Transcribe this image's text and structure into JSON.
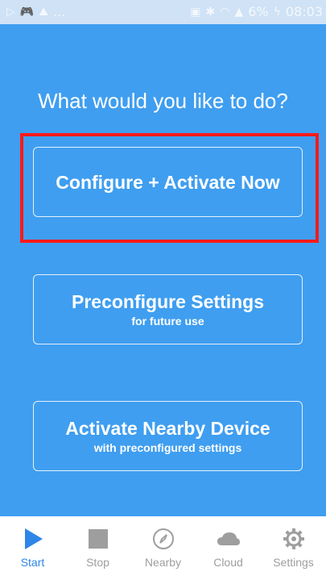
{
  "status_bar": {
    "left_icons": [
      "play-icon",
      "gamepad-icon",
      "mountain-icon"
    ],
    "ellipsis": "...",
    "battery_percent": "6%",
    "time": "08:03",
    "right_icons": [
      "nfc-icon",
      "bluetooth-icon",
      "wifi-icon",
      "signal-icon",
      "battery-charging-icon"
    ]
  },
  "main": {
    "heading": "What would you like to do?",
    "actions": [
      {
        "title": "Configure + Activate Now",
        "subtitle": ""
      },
      {
        "title": "Preconfigure Settings",
        "subtitle": "for future use"
      },
      {
        "title": "Activate Nearby Device",
        "subtitle": "with preconfigured settings"
      }
    ]
  },
  "bottom_nav": {
    "items": [
      {
        "label": "Start",
        "icon": "play-icon",
        "active": true
      },
      {
        "label": "Stop",
        "icon": "stop-icon",
        "active": false
      },
      {
        "label": "Nearby",
        "icon": "compass-icon",
        "active": false
      },
      {
        "label": "Cloud",
        "icon": "cloud-icon",
        "active": false
      },
      {
        "label": "Settings",
        "icon": "gear-icon",
        "active": false
      }
    ]
  },
  "colors": {
    "background": "#3f9ef0",
    "highlight": "#ff1a1a",
    "active": "#2e86e6",
    "inactive": "#9e9e9e"
  }
}
